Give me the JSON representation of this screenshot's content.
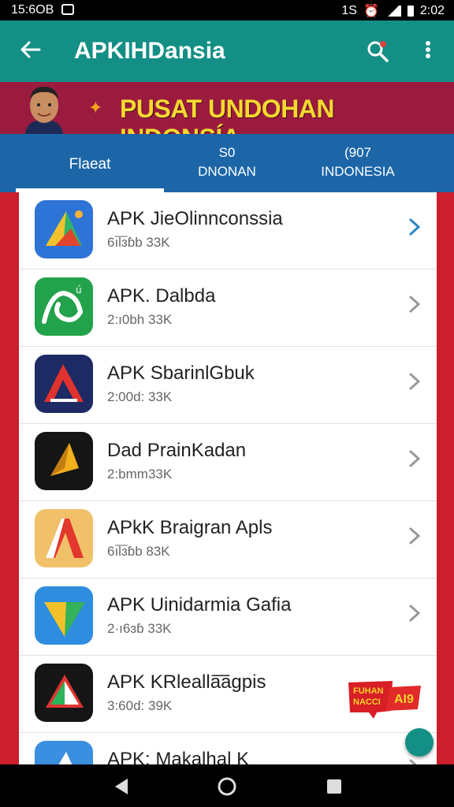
{
  "status_bar": {
    "time": "15:6OB",
    "right_text": "1S",
    "battery_text": "2:02"
  },
  "app_bar": {
    "title": "APKIHDansia"
  },
  "banner": {
    "headline": "PUSAT UNDOHAN INDONSÍA"
  },
  "tabs": [
    {
      "line1": "Flaeat",
      "line2": ""
    },
    {
      "line1": "S0",
      "line2": "DNONAN"
    },
    {
      "line1": "(907",
      "line2": "INDONESIA"
    }
  ],
  "apps": [
    {
      "name": "APK JieOlinnconssia",
      "meta": "6ıl͞ɜɓb 33K",
      "icon": "blue-triangle-icon"
    },
    {
      "name": "APK. Dalbda",
      "meta": "2:ı0bh 33K",
      "icon": "green-loop-icon"
    },
    {
      "name": "APK SbarinlGbuk",
      "meta": "2:00d: 33K",
      "icon": "red-a-icon"
    },
    {
      "name": "Dad PrainKadan",
      "meta": "2:bmm33K",
      "icon": "gold-arrow-icon"
    },
    {
      "name": "APkK Braigran Apls",
      "meta": "6ıl͞ɜɓb 83K",
      "icon": "red-a-cream-icon"
    },
    {
      "name": "APK Uinidarmia Gafia",
      "meta": "2·ı6ɜɓ 33K",
      "icon": "color-triangle-icon"
    },
    {
      "name": "APK KRlealla͞agpis",
      "meta": "3:60d: 39K",
      "icon": "dark-triangle-icon"
    },
    {
      "name": "APK: Makalhal K",
      "meta": "",
      "icon": "blue-triangle-icon"
    }
  ],
  "sticker": {
    "line1": "FUHAN",
    "line2": "NACCI",
    "line3": "AI9"
  },
  "colors": {
    "appbar": "#138f85",
    "tabs": "#1c66a8",
    "banner": "#9b1b3f",
    "headline": "#f4d92f",
    "accent_red": "#cc1f2d"
  }
}
